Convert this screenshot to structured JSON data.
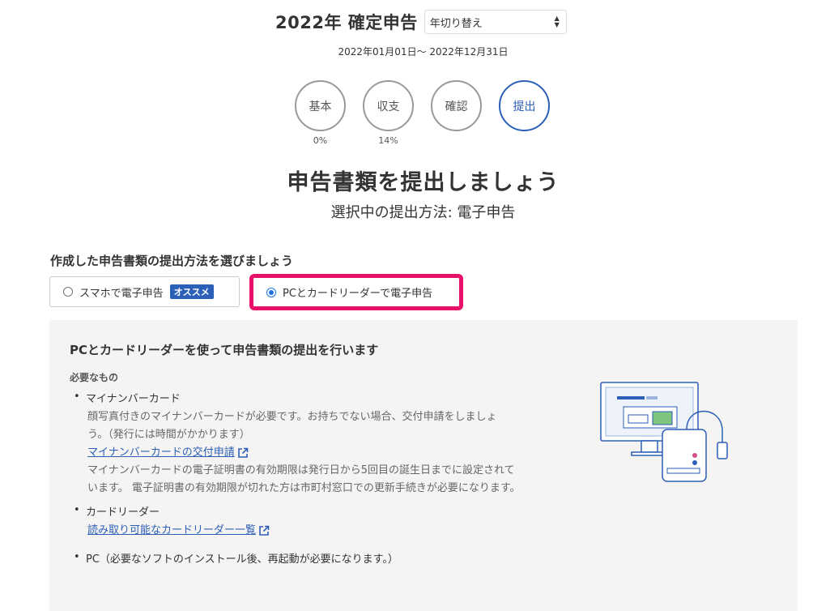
{
  "header": {
    "year_title": "2022年 確定申告",
    "year_switch": "年切り替え",
    "period": "2022年01月01日～ 2022年12月31日"
  },
  "steps": [
    {
      "label": "基本",
      "percent": "0%",
      "active": false
    },
    {
      "label": "収支",
      "percent": "14%",
      "active": false
    },
    {
      "label": "確認",
      "percent": "",
      "active": false
    },
    {
      "label": "提出",
      "percent": "",
      "active": true
    }
  ],
  "main": {
    "title": "申告書類を提出しましょう",
    "method_line": "選択中の提出方法: 電子申告",
    "section_label": "作成した申告書類の提出方法を選びましょう",
    "options": [
      {
        "label": "スマホで電子申告",
        "badge": "オススメ",
        "selected": false
      },
      {
        "label": "PCとカードリーダーで電子申告",
        "selected": true
      }
    ]
  },
  "panel": {
    "title": "PCとカードリーダーを使って申告書類の提出を行います",
    "needs_label": "必要なもの",
    "items": [
      {
        "name": "マイナンバーカード",
        "desc1": "顔写真付きのマイナンバーカードが必要です。お持ちでない場合、交付申請をしましょ",
        "desc2": "う。（発行には時間がかかります）",
        "link": "マイナンバーカードの交付申請",
        "desc3": "マイナンバーカードの電子証明書の有効期限は発行日から5回目の誕生日までに設定されて",
        "desc4": "います。 電子証明書の有効期限が切れた方は市町村窓口での更新手続きが必要になります。"
      },
      {
        "name": "カードリーダー",
        "link": "読み取り可能なカードリーダー一覧"
      },
      {
        "name": "PC（必要なソフトのインストール後、再起動が必要になります。）"
      }
    ]
  },
  "icons": {
    "external_link": "external-link-icon",
    "illustration": "pc-card-reader-illustration"
  },
  "colors": {
    "accent_blue": "#2b5fb8",
    "highlight_pink": "#e8116a",
    "panel_bg": "#f5f4f2"
  }
}
